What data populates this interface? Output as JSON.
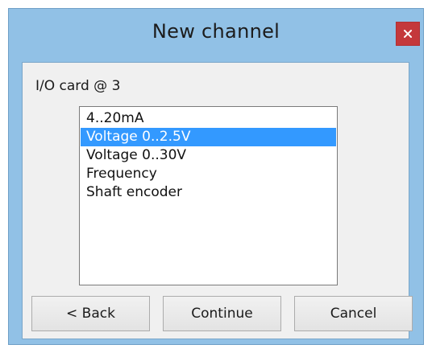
{
  "window": {
    "title": "New channel",
    "close_icon": "close-icon"
  },
  "dialog": {
    "card_label": "I/O card @ 3",
    "list": {
      "items": [
        {
          "label": "4..20mA",
          "selected": false
        },
        {
          "label": "Voltage 0..2.5V",
          "selected": true
        },
        {
          "label": "Voltage 0..30V",
          "selected": false
        },
        {
          "label": "Frequency",
          "selected": false
        },
        {
          "label": "Shaft encoder",
          "selected": false
        }
      ]
    },
    "buttons": {
      "back_label": "< Back",
      "continue_label": "Continue",
      "cancel_label": "Cancel"
    }
  },
  "colors": {
    "frame": "#91c1e6",
    "close": "#c4383b",
    "selection": "#3399ff"
  }
}
